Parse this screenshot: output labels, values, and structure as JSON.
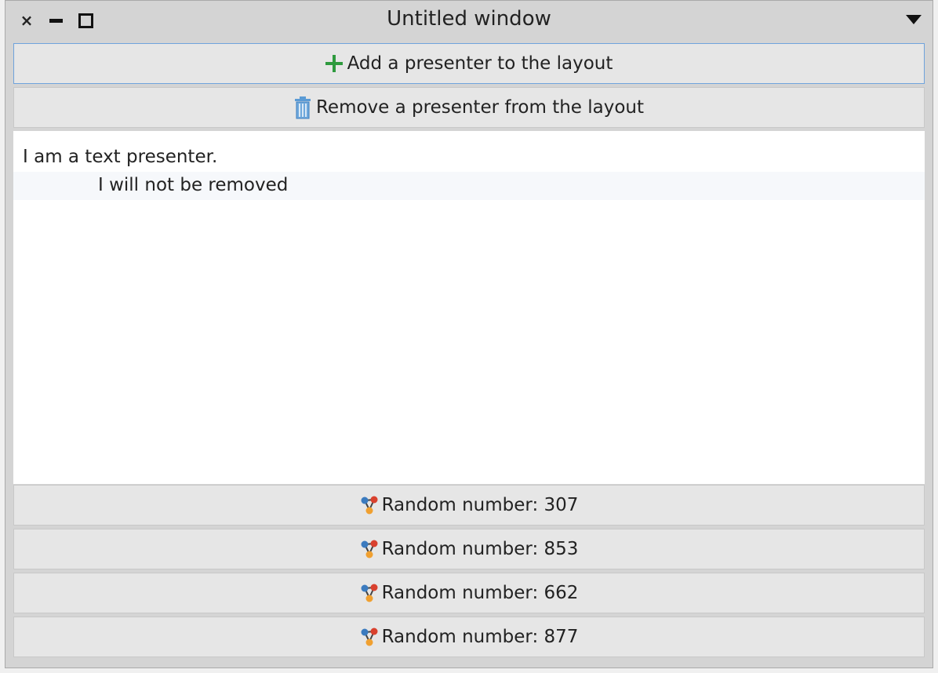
{
  "window": {
    "title": "Untitled window",
    "icons": {
      "close": "close-icon",
      "minimize": "minimize-icon",
      "maximize": "maximize-icon",
      "menu": "window-menu-caret-icon"
    }
  },
  "toolbar": {
    "add_label": "Add a presenter to the layout",
    "add_icon": "add-icon",
    "remove_label": "Remove a presenter from the layout",
    "remove_icon": "trash-icon"
  },
  "text_presenter": {
    "line1": "I am a text presenter.",
    "line2": "I will not be removed"
  },
  "random_buttons": [
    {
      "label": "Random number: 307",
      "icon": "random-icon"
    },
    {
      "label": "Random number: 853",
      "icon": "random-icon"
    },
    {
      "label": "Random number: 662",
      "icon": "random-icon"
    },
    {
      "label": "Random number: 877",
      "icon": "random-icon"
    }
  ],
  "colors": {
    "accent_add": "#2e9a3e",
    "focus_border": "#6fa3dc",
    "trash_blue": "#5b9bd5"
  }
}
